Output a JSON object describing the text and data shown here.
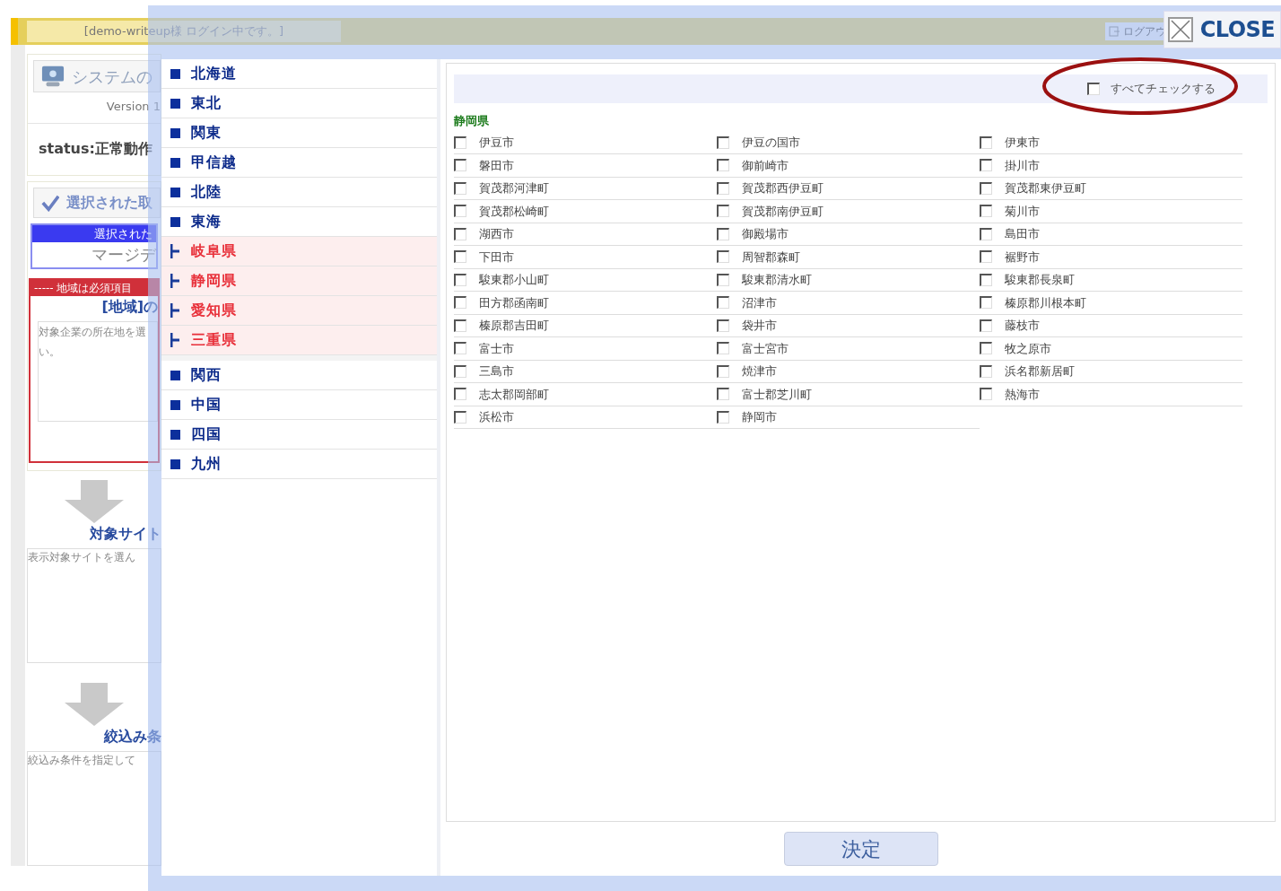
{
  "header": {
    "login_text": "[demo-writeup様 ログイン中です。]",
    "logout": "ログアウ"
  },
  "close_button": {
    "label": "CLOSE"
  },
  "background_panel": {
    "system_title": "システムの",
    "version": "Version 1",
    "status": "status:正常動作",
    "selected_title": "選択された取",
    "selected_bar": "選択された",
    "selected_value": "マージデ",
    "required_notice": "----- 地域は必須項目",
    "region_heading": "[地域]の",
    "region_desc": "対象企業の所在地を選",
    "region_desc_2": "い。",
    "site_heading": "対象サイト",
    "site_desc": "表示対象サイトを選ん",
    "filter_heading": "絞込み条",
    "filter_desc": "絞込み条件を指定して"
  },
  "regions": [
    {
      "label": "北海道"
    },
    {
      "label": "東北"
    },
    {
      "label": "関東"
    },
    {
      "label": "甲信越"
    },
    {
      "label": "北陸"
    },
    {
      "label": "東海",
      "children": [
        {
          "label": "岐阜県"
        },
        {
          "label": "静岡県"
        },
        {
          "label": "愛知県"
        },
        {
          "label": "三重県"
        }
      ]
    },
    {
      "label": "関西"
    },
    {
      "label": "中国"
    },
    {
      "label": "四国"
    },
    {
      "label": "九州"
    }
  ],
  "select_all": {
    "label": "すべてチェックする",
    "checked": false
  },
  "prefecture_title": "静岡県",
  "municipalities": [
    {
      "label": "伊豆市",
      "checked": false
    },
    {
      "label": "伊豆の国市",
      "checked": false
    },
    {
      "label": "伊東市",
      "checked": false
    },
    {
      "label": "磐田市",
      "checked": false
    },
    {
      "label": "御前崎市",
      "checked": false
    },
    {
      "label": "掛川市",
      "checked": false
    },
    {
      "label": "賀茂郡河津町",
      "checked": false
    },
    {
      "label": "賀茂郡西伊豆町",
      "checked": false
    },
    {
      "label": "賀茂郡東伊豆町",
      "checked": false
    },
    {
      "label": "賀茂郡松崎町",
      "checked": false
    },
    {
      "label": "賀茂郡南伊豆町",
      "checked": false
    },
    {
      "label": "菊川市",
      "checked": false
    },
    {
      "label": "湖西市",
      "checked": false
    },
    {
      "label": "御殿場市",
      "checked": false
    },
    {
      "label": "島田市",
      "checked": false
    },
    {
      "label": "下田市",
      "checked": false
    },
    {
      "label": "周智郡森町",
      "checked": false
    },
    {
      "label": "裾野市",
      "checked": false
    },
    {
      "label": "駿東郡小山町",
      "checked": false
    },
    {
      "label": "駿東郡清水町",
      "checked": false
    },
    {
      "label": "駿東郡長泉町",
      "checked": false
    },
    {
      "label": "田方郡函南町",
      "checked": false
    },
    {
      "label": "沼津市",
      "checked": false
    },
    {
      "label": "榛原郡川根本町",
      "checked": false
    },
    {
      "label": "榛原郡吉田町",
      "checked": false
    },
    {
      "label": "袋井市",
      "checked": false
    },
    {
      "label": "藤枝市",
      "checked": false
    },
    {
      "label": "富士市",
      "checked": false
    },
    {
      "label": "富士宮市",
      "checked": false
    },
    {
      "label": "牧之原市",
      "checked": false
    },
    {
      "label": "三島市",
      "checked": false
    },
    {
      "label": "焼津市",
      "checked": false
    },
    {
      "label": "浜名郡新居町",
      "checked": false
    },
    {
      "label": "志太郡岡部町",
      "checked": false
    },
    {
      "label": "富士郡芝川町",
      "checked": false
    },
    {
      "label": "熱海市",
      "checked": false
    },
    {
      "label": "浜松市",
      "checked": false
    },
    {
      "label": "静岡市",
      "checked": false
    }
  ],
  "submit_button": {
    "label": "決定"
  }
}
